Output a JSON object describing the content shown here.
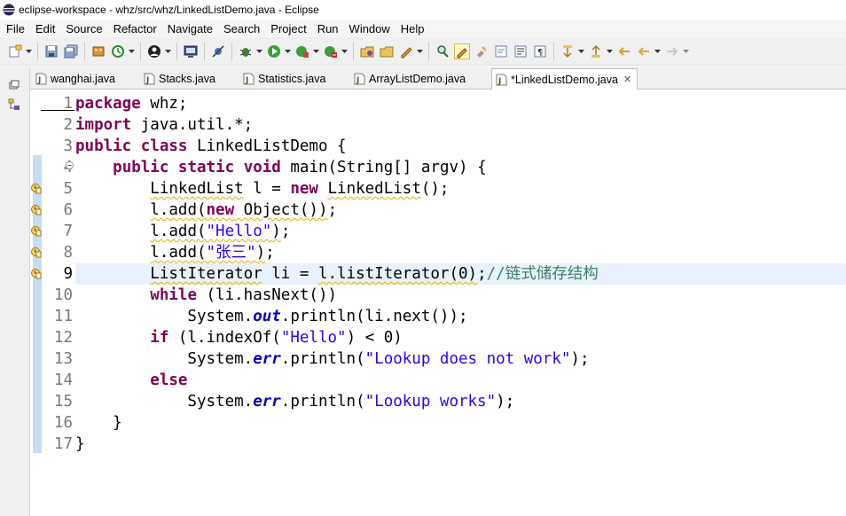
{
  "window": {
    "title": "eclipse-workspace - whz/src/whz/LinkedListDemo.java - Eclipse"
  },
  "menu": [
    "File",
    "Edit",
    "Source",
    "Refactor",
    "Navigate",
    "Search",
    "Project",
    "Run",
    "Window",
    "Help"
  ],
  "toolbar": {
    "icons": [
      "new-icon",
      "save-icon",
      "save-all-icon",
      "build-icon",
      "history-icon",
      "profile-icon",
      "terminal-icon",
      "skip-breakpoints-icon",
      "debug-icon",
      "run-icon",
      "coverage-icon",
      "external-tools-icon",
      "new-package-icon",
      "open-type-icon",
      "open-task-icon",
      "search-icon",
      "toggle-mark-occurrences-icon",
      "block-selection-icon",
      "show-whitespace-icon",
      "word-wrap-icon",
      "pilcrow-icon",
      "next-annotation-icon",
      "prev-annotation-icon",
      "last-edit-icon",
      "back-icon",
      "forward-icon"
    ]
  },
  "tabs": [
    {
      "label": "wanghai.java",
      "active": false
    },
    {
      "label": "Stacks.java",
      "active": false
    },
    {
      "label": "Statistics.java",
      "active": false
    },
    {
      "label": "ArrayListDemo.java",
      "active": false
    },
    {
      "label": "*LinkedListDemo.java",
      "active": true,
      "close": "✕"
    }
  ],
  "editor": {
    "line_numbers": [
      "1",
      "2",
      "3",
      "4",
      "5",
      "6",
      "7",
      "8",
      "9",
      "10",
      "11",
      "12",
      "13",
      "14",
      "15",
      "16",
      "17"
    ],
    "current_line": 9,
    "warning_lines": [
      5,
      6,
      7,
      8,
      9
    ],
    "lines": [
      [
        {
          "t": "package",
          "c": "kw"
        },
        {
          "t": " whz;"
        }
      ],
      [
        {
          "t": "import",
          "c": "kw"
        },
        {
          "t": " java.util.*;"
        }
      ],
      [
        {
          "t": "public",
          "c": "kw"
        },
        {
          "t": " "
        },
        {
          "t": "class",
          "c": "kw"
        },
        {
          "t": " LinkedListDemo {"
        }
      ],
      [
        {
          "t": "    "
        },
        {
          "t": "public",
          "c": "kw"
        },
        {
          "t": " "
        },
        {
          "t": "static",
          "c": "kw"
        },
        {
          "t": " "
        },
        {
          "t": "void",
          "c": "kw"
        },
        {
          "t": " main(String[] argv) {"
        }
      ],
      [
        {
          "t": "        "
        },
        {
          "t": "LinkedList",
          "c": "warn"
        },
        {
          "t": " l = "
        },
        {
          "t": "new",
          "c": "kw"
        },
        {
          "t": " "
        },
        {
          "t": "LinkedList",
          "c": "warn"
        },
        {
          "t": "();"
        }
      ],
      [
        {
          "t": "        "
        },
        {
          "t": "l.add(",
          "c": "warn"
        },
        {
          "t": "new",
          "c": "kw warn"
        },
        {
          "t": " Object())",
          "c": "warn"
        },
        {
          "t": ";"
        }
      ],
      [
        {
          "t": "        "
        },
        {
          "t": "l.add(",
          "c": "warn"
        },
        {
          "t": "\"Hello\"",
          "c": "str warn"
        },
        {
          "t": ")",
          "c": "warn"
        },
        {
          "t": ";"
        }
      ],
      [
        {
          "t": "        "
        },
        {
          "t": "l.add(",
          "c": "warn"
        },
        {
          "t": "\"张三\"",
          "c": "str warn"
        },
        {
          "t": ")",
          "c": "warn"
        },
        {
          "t": ";"
        }
      ],
      [
        {
          "t": "        "
        },
        {
          "t": "ListIterator",
          "c": "warn"
        },
        {
          "t": " li = "
        },
        {
          "t": "l.listIterator(0)",
          "c": "warn"
        },
        {
          "t": ";"
        },
        {
          "t": "//链式储存结构",
          "c": "cmt"
        }
      ],
      [
        {
          "t": "        "
        },
        {
          "t": "while",
          "c": "kw"
        },
        {
          "t": " (li.hasNext())"
        }
      ],
      [
        {
          "t": "            System."
        },
        {
          "t": "out",
          "c": "fld"
        },
        {
          "t": ".println(li.next());"
        }
      ],
      [
        {
          "t": "        "
        },
        {
          "t": "if",
          "c": "kw"
        },
        {
          "t": " (l.indexOf("
        },
        {
          "t": "\"Hello\"",
          "c": "str"
        },
        {
          "t": ") < 0)"
        }
      ],
      [
        {
          "t": "            System."
        },
        {
          "t": "err",
          "c": "fld"
        },
        {
          "t": ".println("
        },
        {
          "t": "\"Lookup does not work\"",
          "c": "str"
        },
        {
          "t": ");"
        }
      ],
      [
        {
          "t": "        "
        },
        {
          "t": "else",
          "c": "kw"
        }
      ],
      [
        {
          "t": "            System."
        },
        {
          "t": "err",
          "c": "fld"
        },
        {
          "t": ".println("
        },
        {
          "t": "\"Lookup works\"",
          "c": "str"
        },
        {
          "t": ");"
        }
      ],
      [
        {
          "t": "    }"
        }
      ],
      [
        {
          "t": "}"
        }
      ]
    ]
  }
}
